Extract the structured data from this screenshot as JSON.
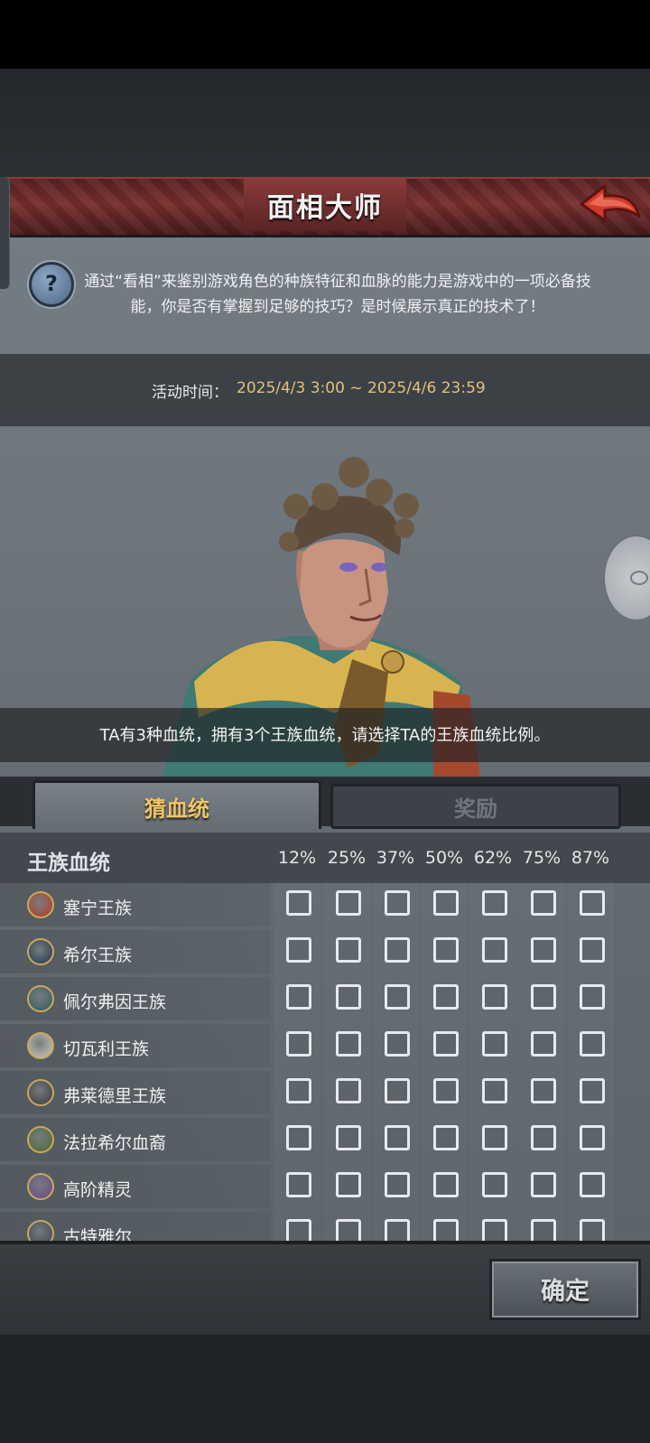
{
  "title": "面相大师",
  "description": "通过“看相”来鉴别游戏角色的种族特征和血脉的能力是游戏中的一项必备技能，你是否有掌握到足够的技巧？是时候展示真正的技术了！",
  "event_time": {
    "label": "活动时间：",
    "value": "2025/4/3 3:00 ~ 2025/4/6 23:59"
  },
  "clue": "TA有3种血统，拥有3个王族血统，请选择TA的王族血统比例。",
  "tabs": [
    {
      "label": "猜血统",
      "active": true
    },
    {
      "label": "奖励",
      "active": false
    }
  ],
  "grid": {
    "header": "王族血统",
    "percentages": [
      "12%",
      "25%",
      "37%",
      "50%",
      "62%",
      "75%",
      "87%"
    ],
    "rows": [
      {
        "name": "塞宁王族",
        "emblem_color": "#b5381f"
      },
      {
        "name": "希尔王族",
        "emblem_color": "#1d3550"
      },
      {
        "name": "佩尔弗因王族",
        "emblem_color": "#2e5b5c"
      },
      {
        "name": "切瓦利王族",
        "emblem_color": "#cfc9b8"
      },
      {
        "name": "弗莱德里王族",
        "emblem_color": "#3a3a3a"
      },
      {
        "name": "法拉希尔血裔",
        "emblem_color": "#4b6a2a"
      },
      {
        "name": "高阶精灵",
        "emblem_color": "#6b4a85"
      },
      {
        "name": "古特雅尔",
        "emblem_color": "#3a4550"
      }
    ]
  },
  "confirm_label": "确定",
  "colors": {
    "accent_gold": "#e2c178",
    "tab_active_text": "#f0c463",
    "title_bar": "#6a2a2a"
  },
  "icons": {
    "help": "question-icon",
    "back": "back-arrow-icon"
  }
}
